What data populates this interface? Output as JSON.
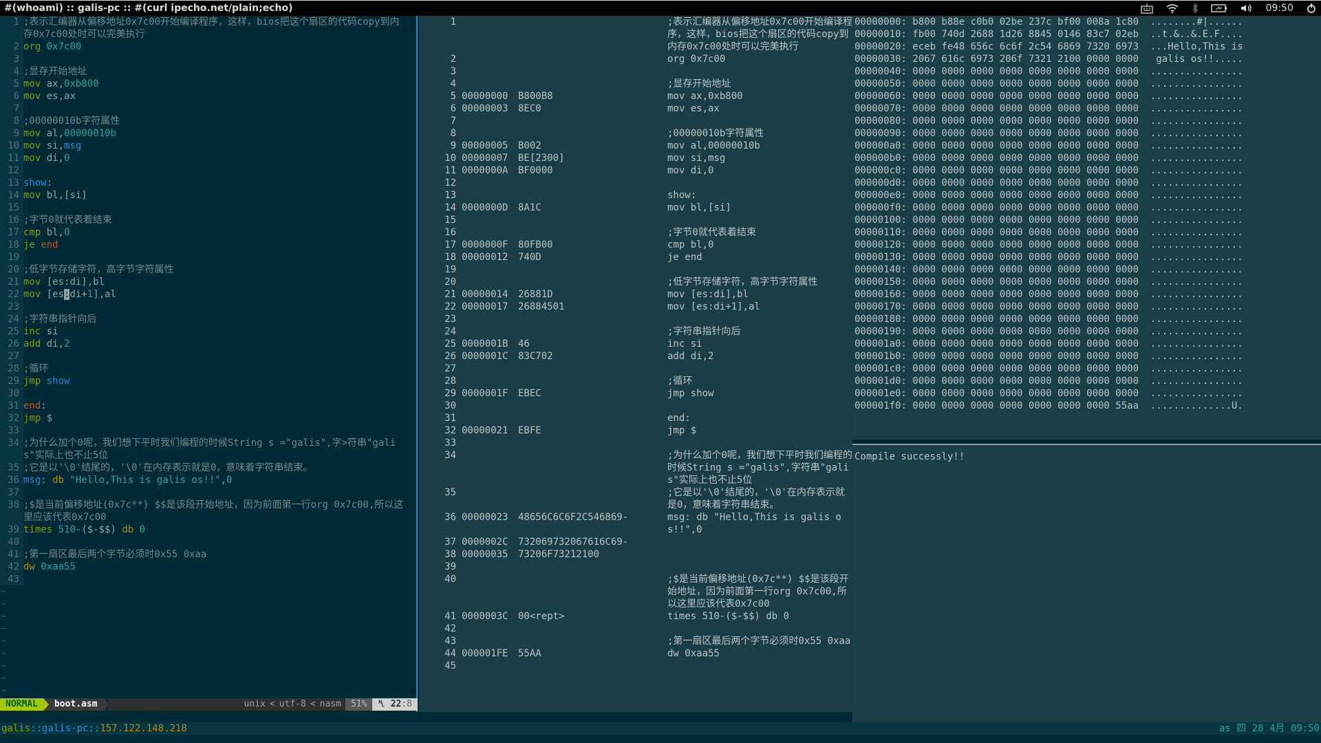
{
  "topbar": {
    "title": "#(whoami) :: galis-pc :: #(curl ipecho.net/plain;echo)",
    "clock": "09:50",
    "icons": [
      "keyboard-icon",
      "wifi-icon",
      "bluetooth-icon",
      "battery-icon",
      "volume-icon",
      "power-icon"
    ]
  },
  "vim": {
    "lines": [
      {
        "n": "1",
        "parts": [
          [
            "cm",
            ";表示汇编器从偏移地址0x7c00开始编译程序，这样，bios把这个扇区的代码copy到内存0x7c00处时可以完美执行"
          ]
        ]
      },
      {
        "n": "2",
        "parts": [
          [
            "kw",
            "org"
          ],
          [
            "",
            " "
          ],
          [
            "num",
            "0x7c00"
          ]
        ]
      },
      {
        "n": "3",
        "parts": []
      },
      {
        "n": "4",
        "parts": [
          [
            "cm",
            ";显存开始地址"
          ]
        ]
      },
      {
        "n": "5",
        "parts": [
          [
            "kw",
            "mov"
          ],
          [
            "",
            " ax,"
          ],
          [
            "num",
            "0xb800"
          ]
        ]
      },
      {
        "n": "6",
        "parts": [
          [
            "kw",
            "mov"
          ],
          [
            "",
            " es,ax"
          ]
        ]
      },
      {
        "n": "7",
        "parts": []
      },
      {
        "n": "8",
        "parts": [
          [
            "cm",
            ";00000010b字符属性"
          ]
        ]
      },
      {
        "n": "9",
        "parts": [
          [
            "kw",
            "mov"
          ],
          [
            "",
            " al,"
          ],
          [
            "num",
            "00000010b"
          ]
        ]
      },
      {
        "n": "10",
        "parts": [
          [
            "kw",
            "mov"
          ],
          [
            "",
            " si,"
          ],
          [
            "lbl",
            "msg"
          ]
        ]
      },
      {
        "n": "11",
        "parts": [
          [
            "kw",
            "mov"
          ],
          [
            "",
            " di,"
          ],
          [
            "num",
            "0"
          ]
        ]
      },
      {
        "n": "12",
        "parts": []
      },
      {
        "n": "13",
        "parts": [
          [
            "lbl",
            "show"
          ],
          [
            "",
            ":"
          ]
        ]
      },
      {
        "n": "14",
        "parts": [
          [
            "kw",
            "mov"
          ],
          [
            "",
            " bl,[si]"
          ]
        ]
      },
      {
        "n": "15",
        "parts": []
      },
      {
        "n": "16",
        "parts": [
          [
            "cm",
            ";字节0就代表着结束"
          ]
        ]
      },
      {
        "n": "17",
        "parts": [
          [
            "kw",
            "cmp"
          ],
          [
            "",
            " bl,"
          ],
          [
            "num",
            "0"
          ]
        ]
      },
      {
        "n": "18",
        "parts": [
          [
            "kw",
            "je"
          ],
          [
            "",
            " "
          ],
          [
            "red",
            "end"
          ]
        ]
      },
      {
        "n": "19",
        "parts": []
      },
      {
        "n": "20",
        "parts": [
          [
            "cm",
            ";低字节存储字符，高字节字符属性"
          ]
        ]
      },
      {
        "n": "21",
        "parts": [
          [
            "kw",
            "mov"
          ],
          [
            "",
            " [es:di],bl"
          ]
        ]
      },
      {
        "n": "22",
        "parts": [
          [
            "kw",
            "mov"
          ],
          [
            "",
            " [es"
          ],
          [
            "cursor",
            ":"
          ],
          [
            "",
            "di+"
          ],
          [
            "num",
            "1"
          ],
          [
            "",
            "],al"
          ]
        ]
      },
      {
        "n": "23",
        "parts": []
      },
      {
        "n": "24",
        "parts": [
          [
            "cm",
            ";字符串指针向后"
          ]
        ]
      },
      {
        "n": "25",
        "parts": [
          [
            "kw",
            "inc"
          ],
          [
            "",
            " si"
          ]
        ]
      },
      {
        "n": "26",
        "parts": [
          [
            "kw",
            "add"
          ],
          [
            "",
            " di,"
          ],
          [
            "num",
            "2"
          ]
        ]
      },
      {
        "n": "27",
        "parts": []
      },
      {
        "n": "28",
        "parts": [
          [
            "cm",
            ";循环"
          ]
        ]
      },
      {
        "n": "29",
        "parts": [
          [
            "kw",
            "jmp"
          ],
          [
            "",
            " "
          ],
          [
            "lbl",
            "show"
          ]
        ]
      },
      {
        "n": "30",
        "parts": []
      },
      {
        "n": "31",
        "parts": [
          [
            "red",
            "end"
          ],
          [
            "",
            ":"
          ]
        ]
      },
      {
        "n": "32",
        "parts": [
          [
            "kw",
            "jmp"
          ],
          [
            "",
            " $"
          ]
        ]
      },
      {
        "n": "33",
        "parts": []
      },
      {
        "n": "34",
        "parts": [
          [
            "cm",
            ";为什么加个0呢，我们想下平时我们编程的时候String s =\"galis\",字>符串\"galis\"实际上也不止5位"
          ]
        ]
      },
      {
        "n": "35",
        "parts": [
          [
            "cm",
            ";它是以'\\0'结尾的，'\\0'在内存表示就是0，意味着字符串结束。"
          ]
        ]
      },
      {
        "n": "36",
        "parts": [
          [
            "lbl",
            "msg"
          ],
          [
            "",
            ": "
          ],
          [
            "dir",
            "db"
          ],
          [
            "",
            " "
          ],
          [
            "str",
            "\"Hello,This is galis os!!\""
          ],
          [
            "",
            ","
          ],
          [
            "num",
            "0"
          ]
        ]
      },
      {
        "n": "37",
        "parts": []
      },
      {
        "n": "38",
        "parts": [
          [
            "cm",
            ";$是当前偏移地址(0x7c**) $$是该段开始地址，因为前面第一行org 0x7c00,所以这里应该代表0x7c00"
          ]
        ]
      },
      {
        "n": "39",
        "parts": [
          [
            "kw",
            "times"
          ],
          [
            "",
            " "
          ],
          [
            "num",
            "510"
          ],
          [
            "",
            "-($-$$) "
          ],
          [
            "dir",
            "db"
          ],
          [
            "",
            " "
          ],
          [
            "num",
            "0"
          ]
        ]
      },
      {
        "n": "40",
        "parts": []
      },
      {
        "n": "41",
        "parts": [
          [
            "cm",
            ";第一扇区最后两个字节必须时0x55 0xaa"
          ]
        ]
      },
      {
        "n": "42",
        "parts": [
          [
            "dir",
            "dw"
          ],
          [
            "",
            " "
          ],
          [
            "num",
            "0xaa55"
          ]
        ]
      },
      {
        "n": "43",
        "parts": []
      }
    ],
    "tilde_count": 10,
    "status": {
      "mode": "NORMAL",
      "file": "boot.asm",
      "fileformat": "unix",
      "encoding": "utf-8",
      "filetype": "nasm",
      "percent": "51%",
      "line": "22",
      "col": "8"
    }
  },
  "listing": {
    "lines": [
      {
        "n": "1",
        "addr": "",
        "hex": "",
        "src": ";表示汇编器从偏移地址0x7c00开始编译程序，这样，bios把这个扇区的代码copy到内存0x7c00处时可以完美执行"
      },
      {
        "n": "2",
        "addr": "",
        "hex": "",
        "src": "org 0x7c00"
      },
      {
        "n": "3",
        "addr": "",
        "hex": "",
        "src": ""
      },
      {
        "n": "4",
        "addr": "",
        "hex": "",
        "src": ";显存开始地址"
      },
      {
        "n": "5",
        "addr": "00000000",
        "hex": "B800B8",
        "src": "mov ax,0xb800"
      },
      {
        "n": "6",
        "addr": "00000003",
        "hex": "8EC0",
        "src": "mov es,ax"
      },
      {
        "n": "7",
        "addr": "",
        "hex": "",
        "src": ""
      },
      {
        "n": "8",
        "addr": "",
        "hex": "",
        "src": ";00000010b字符属性"
      },
      {
        "n": "9",
        "addr": "00000005",
        "hex": "B002",
        "src": "mov al,00000010b"
      },
      {
        "n": "10",
        "addr": "00000007",
        "hex": "BE[2300]",
        "src": "mov si,msg"
      },
      {
        "n": "11",
        "addr": "0000000A",
        "hex": "BF0000",
        "src": "mov di,0"
      },
      {
        "n": "12",
        "addr": "",
        "hex": "",
        "src": ""
      },
      {
        "n": "13",
        "addr": "",
        "hex": "",
        "src": "show:"
      },
      {
        "n": "14",
        "addr": "0000000D",
        "hex": "8A1C",
        "src": "mov bl,[si]"
      },
      {
        "n": "15",
        "addr": "",
        "hex": "",
        "src": ""
      },
      {
        "n": "16",
        "addr": "",
        "hex": "",
        "src": ";字节0就代表着结束"
      },
      {
        "n": "17",
        "addr": "0000000F",
        "hex": "80FB00",
        "src": "cmp bl,0"
      },
      {
        "n": "18",
        "addr": "00000012",
        "hex": "740D",
        "src": "je end"
      },
      {
        "n": "19",
        "addr": "",
        "hex": "",
        "src": ""
      },
      {
        "n": "20",
        "addr": "",
        "hex": "",
        "src": ";低字节存储字符，高字节字符属性"
      },
      {
        "n": "21",
        "addr": "00000014",
        "hex": "26881D",
        "src": "mov [es:di],bl"
      },
      {
        "n": "22",
        "addr": "00000017",
        "hex": "26884501",
        "src": "mov [es:di+1],al"
      },
      {
        "n": "23",
        "addr": "",
        "hex": "",
        "src": ""
      },
      {
        "n": "24",
        "addr": "",
        "hex": "",
        "src": ";字符串指针向后"
      },
      {
        "n": "25",
        "addr": "0000001B",
        "hex": "46",
        "src": "inc si"
      },
      {
        "n": "26",
        "addr": "0000001C",
        "hex": "83C702",
        "src": "add di,2"
      },
      {
        "n": "27",
        "addr": "",
        "hex": "",
        "src": ""
      },
      {
        "n": "28",
        "addr": "",
        "hex": "",
        "src": ";循环"
      },
      {
        "n": "29",
        "addr": "0000001F",
        "hex": "EBEC",
        "src": "jmp show"
      },
      {
        "n": "30",
        "addr": "",
        "hex": "",
        "src": ""
      },
      {
        "n": "31",
        "addr": "",
        "hex": "",
        "src": "end:"
      },
      {
        "n": "32",
        "addr": "00000021",
        "hex": "EBFE",
        "src": "jmp $"
      },
      {
        "n": "33",
        "addr": "",
        "hex": "",
        "src": ""
      },
      {
        "n": "34",
        "addr": "",
        "hex": "",
        "src": ";为什么加个0呢，我们想下平时我们编程的时候String s =\"galis\",字符串\"galis\"实际上也不止5位"
      },
      {
        "n": "35",
        "addr": "",
        "hex": "",
        "src": ";它是以'\\0'结尾的，'\\0'在内存表示就是0，意味着字符串结束。"
      },
      {
        "n": "36",
        "addr": "00000023",
        "hex": "48656C6C6F2C546869-",
        "src": "msg: db \"Hello,This is galis os!!\",0"
      },
      {
        "n": "37",
        "addr": "0000002C",
        "hex": "732069732067616C69-",
        "src": ""
      },
      {
        "n": "38",
        "addr": "00000035",
        "hex": "73206F73212100",
        "src": ""
      },
      {
        "n": "39",
        "addr": "",
        "hex": "",
        "src": ""
      },
      {
        "n": "40",
        "addr": "",
        "hex": "",
        "src": ";$是当前偏移地址(0x7c**) $$是该段开始地址，因为前面第一行org 0x7c00,所以这里应该代表0x7c00"
      },
      {
        "n": "41",
        "addr": "0000003C",
        "hex": "00<rept>",
        "src": "times 510-($-$$) db 0"
      },
      {
        "n": "42",
        "addr": "",
        "hex": "",
        "src": ""
      },
      {
        "n": "43",
        "addr": "",
        "hex": "",
        "src": ";第一扇区最后两个字节必须时0x55 0xaa"
      },
      {
        "n": "44",
        "addr": "000001FE",
        "hex": "55AA",
        "src": "dw 0xaa55"
      },
      {
        "n": "45",
        "addr": "",
        "hex": "",
        "src": ""
      }
    ]
  },
  "hexdump": {
    "rows": [
      "00000000: b800 b88e c0b0 02be 237c bf00 008a 1c80  ........#|......",
      "00000010: fb00 740d 2688 1d26 8845 0146 83c7 02eb  ..t.&..&.E.F....",
      "00000020: eceb fe48 656c 6c6f 2c54 6869 7320 6973  ...Hello,This is",
      "00000030: 2067 616c 6973 206f 7321 2100 0000 0000   galis os!!.....",
      "00000040: 0000 0000 0000 0000 0000 0000 0000 0000  ................",
      "00000050: 0000 0000 0000 0000 0000 0000 0000 0000  ................",
      "00000060: 0000 0000 0000 0000 0000 0000 0000 0000  ................",
      "00000070: 0000 0000 0000 0000 0000 0000 0000 0000  ................",
      "00000080: 0000 0000 0000 0000 0000 0000 0000 0000  ................",
      "00000090: 0000 0000 0000 0000 0000 0000 0000 0000  ................",
      "000000a0: 0000 0000 0000 0000 0000 0000 0000 0000  ................",
      "000000b0: 0000 0000 0000 0000 0000 0000 0000 0000  ................",
      "000000c0: 0000 0000 0000 0000 0000 0000 0000 0000  ................",
      "000000d0: 0000 0000 0000 0000 0000 0000 0000 0000  ................",
      "000000e0: 0000 0000 0000 0000 0000 0000 0000 0000  ................",
      "000000f0: 0000 0000 0000 0000 0000 0000 0000 0000  ................",
      "00000100: 0000 0000 0000 0000 0000 0000 0000 0000  ................",
      "00000110: 0000 0000 0000 0000 0000 0000 0000 0000  ................",
      "00000120: 0000 0000 0000 0000 0000 0000 0000 0000  ................",
      "00000130: 0000 0000 0000 0000 0000 0000 0000 0000  ................",
      "00000140: 0000 0000 0000 0000 0000 0000 0000 0000  ................",
      "00000150: 0000 0000 0000 0000 0000 0000 0000 0000  ................",
      "00000160: 0000 0000 0000 0000 0000 0000 0000 0000  ................",
      "00000170: 0000 0000 0000 0000 0000 0000 0000 0000  ................",
      "00000180: 0000 0000 0000 0000 0000 0000 0000 0000  ................",
      "00000190: 0000 0000 0000 0000 0000 0000 0000 0000  ................",
      "000001a0: 0000 0000 0000 0000 0000 0000 0000 0000  ................",
      "000001b0: 0000 0000 0000 0000 0000 0000 0000 0000  ................",
      "000001c0: 0000 0000 0000 0000 0000 0000 0000 0000  ................",
      "000001d0: 0000 0000 0000 0000 0000 0000 0000 0000  ................",
      "000001e0: 0000 0000 0000 0000 0000 0000 0000 0000  ................",
      "000001f0: 0000 0000 0000 0000 0000 0000 0000 55aa  ..............U."
    ]
  },
  "output": {
    "message": "Compile successly!!"
  },
  "prompt": {
    "user": "galis",
    "sep": "::",
    "host": "galis-pc",
    "ip": "157.122.148.218",
    "right": "as 四 28  4月 09:50"
  }
}
